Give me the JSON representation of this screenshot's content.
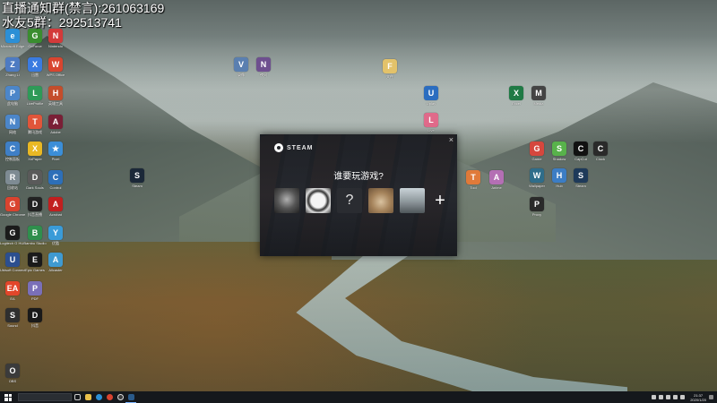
{
  "overlay": {
    "line1": "直播通知群(禁言):261063169",
    "line2": "水友5群：292513741"
  },
  "desktop_icons": [
    {
      "label": "Microsoft Edge",
      "color": "#2b8fd6",
      "glyph": "e"
    },
    {
      "label": "GeForce",
      "color": "#3a8d2f",
      "glyph": "G"
    },
    {
      "label": "Nintendo",
      "color": "#d33a3a",
      "glyph": "N"
    },
    {
      "label": "Zhang Li",
      "color": "#4e7bc2",
      "glyph": "Z"
    },
    {
      "label": "迅雷",
      "color": "#3a7be0",
      "glyph": "X"
    },
    {
      "label": "WPS Office",
      "color": "#d8452f",
      "glyph": "W"
    },
    {
      "label": "此电脑",
      "color": "#4c86c9",
      "glyph": "P"
    },
    {
      "label": "LiveProfile",
      "color": "#2e9a58",
      "glyph": "L"
    },
    {
      "label": "英雄工具",
      "color": "#c44d2b",
      "glyph": "H"
    },
    {
      "label": "网络",
      "color": "#4c86c9",
      "glyph": "N"
    },
    {
      "label": "腾讯游戏",
      "color": "#e0553a",
      "glyph": "T"
    },
    {
      "label": "Adobe",
      "color": "#7a1f36",
      "glyph": "A"
    },
    {
      "label": "控制面板",
      "color": "#3f7fc6",
      "glyph": "C"
    },
    {
      "label": "XnPaper",
      "color": "#e9b824",
      "glyph": "X"
    },
    {
      "label": "Pixel",
      "color": "#3b8ed8",
      "glyph": "★"
    },
    {
      "label": "回收站",
      "color": "#7e8b93",
      "glyph": "R"
    },
    {
      "label": "Dark Souls",
      "color": "#5a5a5a",
      "glyph": "D"
    },
    {
      "label": "Control",
      "color": "#2d6fb8",
      "glyph": "C"
    },
    {
      "label": "Google Chrome",
      "color": "#d9432f",
      "glyph": "G"
    },
    {
      "label": "抖音直播",
      "color": "#222222",
      "glyph": "D"
    },
    {
      "label": "Acrobat",
      "color": "#c21f1f",
      "glyph": "A"
    },
    {
      "label": "Logitech G HUB",
      "color": "#1b1b1b",
      "glyph": "G"
    },
    {
      "label": "Bambu Studio",
      "color": "#2f8f4d",
      "glyph": "B"
    },
    {
      "label": "优酷",
      "color": "#3a9bd8",
      "glyph": "Y"
    },
    {
      "label": "Ubisoft Connect",
      "color": "#2c4f8f",
      "glyph": "U"
    },
    {
      "label": "Epic Games",
      "color": "#1a1a1a",
      "glyph": "E"
    },
    {
      "label": "Allcaster",
      "color": "#3f9ad1",
      "glyph": "A"
    },
    {
      "label": "EA",
      "color": "#e2462a",
      "glyph": "EA"
    },
    {
      "label": "PDF",
      "color": "#7a6fb8",
      "glyph": "P"
    },
    {
      "label": "Sound",
      "color": "#2f2f2f",
      "glyph": "S"
    },
    {
      "label": "抖音",
      "color": "#1a1a1a",
      "glyph": "D"
    },
    {
      "label": "OBS",
      "color": "#3b3b3b",
      "glyph": "O"
    },
    {
      "label": "文件",
      "color": "#e3c26a",
      "glyph": "F"
    },
    {
      "label": "录像",
      "color": "#5a7fb0",
      "glyph": "V"
    },
    {
      "label": "夜间",
      "color": "#6e4f8f",
      "glyph": "N"
    },
    {
      "label": "Steam",
      "color": "#1b2838",
      "glyph": "S"
    },
    {
      "label": "Excel",
      "color": "#1f7a45",
      "glyph": "X"
    },
    {
      "label": "Media",
      "color": "#444444",
      "glyph": "M"
    },
    {
      "label": "Uplay",
      "color": "#2b6dc0",
      "glyph": "U"
    },
    {
      "label": "Live",
      "color": "#e06a8a",
      "glyph": "L"
    },
    {
      "label": "Game",
      "color": "#d5473d",
      "glyph": "G"
    },
    {
      "label": "Shadow",
      "color": "#58b24b",
      "glyph": "S"
    },
    {
      "label": "CapCut",
      "color": "#111111",
      "glyph": "C"
    },
    {
      "label": "Clock",
      "color": "#2a2a2a",
      "glyph": "C"
    },
    {
      "label": "Wallpaper",
      "color": "#2f6d8a",
      "glyph": "W"
    },
    {
      "label": "Hub",
      "color": "#3c7dc4",
      "glyph": "H"
    },
    {
      "label": "Steam",
      "color": "#1e3a5a",
      "glyph": "S"
    },
    {
      "label": "Tool",
      "color": "#e07a3a",
      "glyph": "T"
    },
    {
      "label": "Anime",
      "color": "#b46fb4",
      "glyph": "A"
    },
    {
      "label": "Proxy",
      "color": "#2a2a2a",
      "glyph": "P"
    }
  ],
  "steam": {
    "brand": "STEAM",
    "close": "×",
    "prompt": "谁要玩游戏?",
    "unknown_account": "?",
    "add": "+"
  },
  "taskbar": {
    "search_placeholder": "",
    "time": "21:37",
    "date": "2020/1/20"
  }
}
